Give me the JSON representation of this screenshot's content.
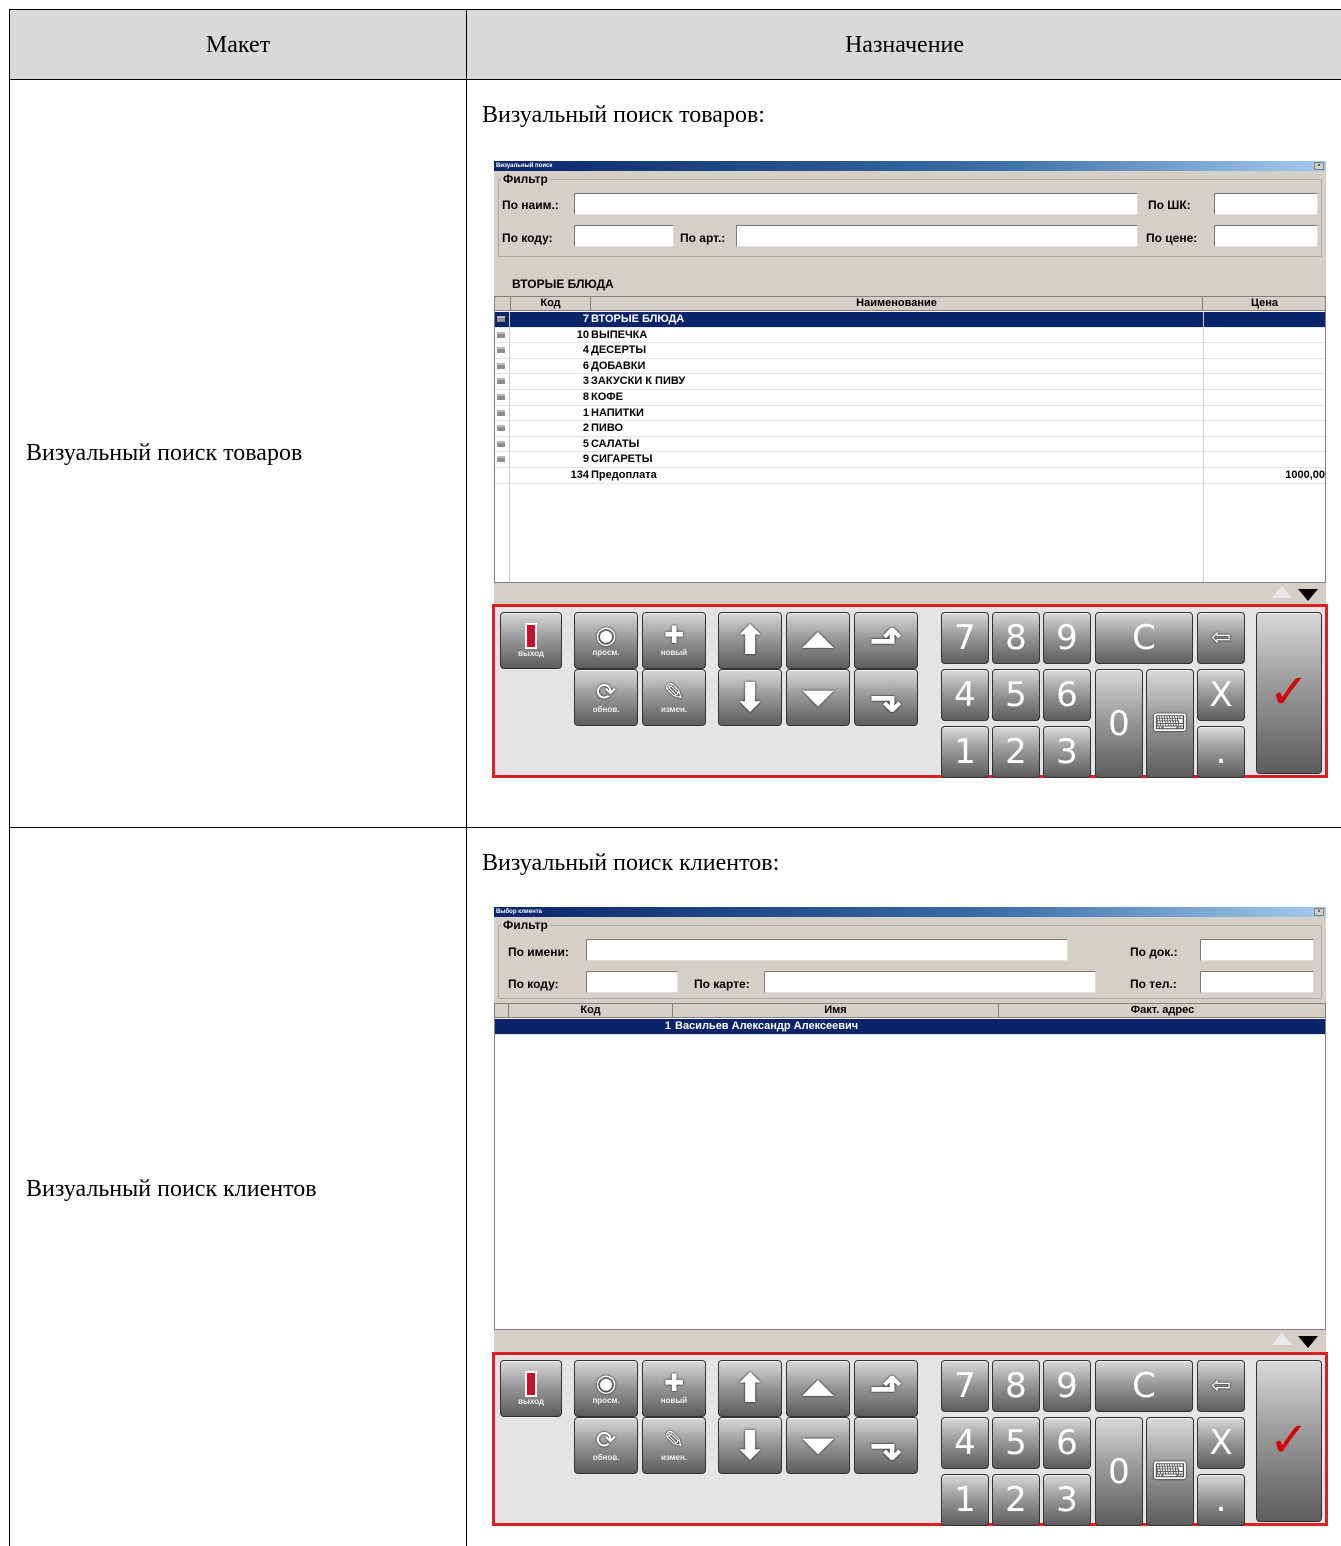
{
  "table": {
    "header_left": "Макет",
    "header_right": "Назначение",
    "rows": [
      {
        "label": "Визуальный поиск товаров",
        "title": "Визуальный поиск товаров:"
      },
      {
        "label": "Визуальный поиск клиентов",
        "title": "Визуальный поиск клиентов:"
      }
    ]
  },
  "goods_window": {
    "title": "Визуальный поиск",
    "close": "×",
    "filter": {
      "legend": "Фильтр",
      "by_name": "По наим.:",
      "by_barcode": "По ШК:",
      "by_code": "По коду:",
      "by_article": "По арт.:",
      "by_price": "По цене:"
    },
    "group_title": "ВТОРЫЕ БЛЮДА",
    "columns": {
      "code": "Код",
      "name": "Наименование",
      "price": "Цена"
    },
    "rows": [
      {
        "code": "7",
        "name": "ВТОРЫЕ БЛЮДА",
        "price": "",
        "folder": true,
        "selected": true
      },
      {
        "code": "10",
        "name": "ВЫПЕЧКА",
        "price": "",
        "folder": true
      },
      {
        "code": "4",
        "name": "ДЕСЕРТЫ",
        "price": "",
        "folder": true
      },
      {
        "code": "6",
        "name": "ДОБАВКИ",
        "price": "",
        "folder": true
      },
      {
        "code": "3",
        "name": "ЗАКУСКИ К ПИВУ",
        "price": "",
        "folder": true
      },
      {
        "code": "8",
        "name": "КОФЕ",
        "price": "",
        "folder": true
      },
      {
        "code": "1",
        "name": "НАПИТКИ",
        "price": "",
        "folder": true
      },
      {
        "code": "2",
        "name": "ПИВО",
        "price": "",
        "folder": true
      },
      {
        "code": "5",
        "name": "САЛАТЫ",
        "price": "",
        "folder": true
      },
      {
        "code": "9",
        "name": "СИГАРЕТЫ",
        "price": "",
        "folder": true
      },
      {
        "code": "134",
        "name": "Предоплата",
        "price": "1000,00",
        "folder": false
      }
    ]
  },
  "client_window": {
    "title": "Выбор клиента",
    "close": "×",
    "filter": {
      "legend": "Фильтр",
      "by_name": "По имени:",
      "by_doc": "По док.:",
      "by_code": "По коду:",
      "by_card": "По карте:",
      "by_phone": "По тел.:"
    },
    "columns": {
      "code": "Код",
      "name": "Имя",
      "address": "Факт. адрес"
    },
    "rows": [
      {
        "code": "1",
        "name": "Васильев Александр Алексеевич",
        "address": "",
        "selected": true
      }
    ]
  },
  "keypad": {
    "exit": "выход",
    "view": "просм.",
    "new": "новый",
    "refresh": "обнов.",
    "edit": "измен.",
    "keys": [
      "7",
      "8",
      "9",
      "C",
      "4",
      "5",
      "6",
      "X",
      "1",
      "2",
      "3",
      "0",
      "."
    ],
    "icons": {
      "exit": "door-icon",
      "view": "eye-icon",
      "new": "plus-icon",
      "refresh": "refresh-icon",
      "edit": "pencil-icon",
      "up": "arrow-up-icon",
      "page_up": "page-up-icon",
      "home": "arrow-up-bent-icon",
      "down": "arrow-down-icon",
      "page_down": "page-down-icon",
      "end": "arrow-down-bent-icon",
      "backspace": "backspace-icon",
      "keyboard": "keyboard-icon",
      "ok": "checkmark-icon"
    },
    "accent": "#e02020"
  }
}
